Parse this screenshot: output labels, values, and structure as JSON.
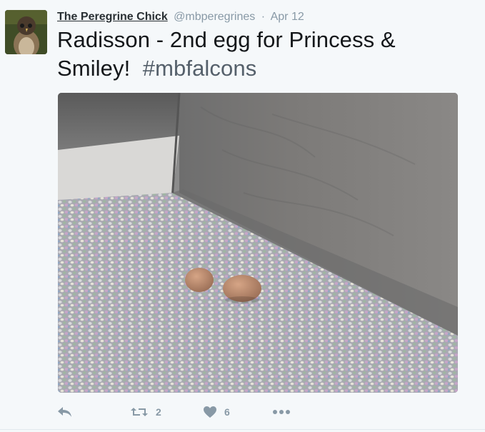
{
  "author": {
    "name": "The Peregrine Chick",
    "handle": "@mbperegrines",
    "separator": "·",
    "time": "Apr 12"
  },
  "tweet": {
    "text": "Radisson - 2nd egg for Princess & Smiley!",
    "hashtag": "#mbfalcons"
  },
  "actions": {
    "reply_icon": "reply-icon",
    "retweet_icon": "retweet-icon",
    "retweet_count": "2",
    "like_icon": "heart-icon",
    "like_count": "6",
    "more_icon": "more-icon"
  },
  "colors": {
    "background": "#f5f8fa",
    "name": "#292f33",
    "meta": "#8899a6",
    "text": "#14171a"
  }
}
